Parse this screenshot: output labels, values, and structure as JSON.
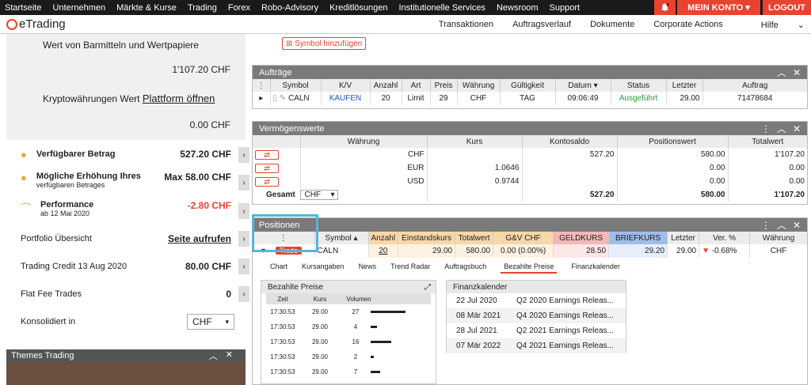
{
  "topnav": {
    "items": [
      "Startseite",
      "Unternehmen",
      "Märkte & Kurse",
      "Trading",
      "Forex",
      "Robo-Advisory",
      "Kreditlösungen",
      "Institutionelle Services",
      "Newsroom",
      "Support"
    ],
    "konto": "MEIN KONTO",
    "logout": "LOGOUT"
  },
  "subnav": {
    "logo": "eTrading",
    "links": [
      "Transaktionen",
      "Auftragsverlauf",
      "Dokumente",
      "Corporate Actions",
      "Hilfe"
    ]
  },
  "left": {
    "wert_label": "Wert von Barmitteln und Wertpapiere",
    "wert_value": "1'107.20 CHF",
    "krypto_label": "Kryptowährungen Wert",
    "krypto_link": "Plattform öffnen",
    "krypto_value": "0.00 CHF",
    "verf_label": "Verfügbarer Betrag",
    "verf_value": "527.20 CHF",
    "erh_label1": "Mögliche Erhöhung Ihres",
    "erh_label2": "verfügbaren Betrages",
    "erh_value": "Max 58.00 CHF",
    "perf_label": "Performance",
    "perf_date": "ab 12 Mai 2020",
    "perf_value": "-2.80 CHF",
    "portfolio_label": "Portfolio Übersicht",
    "portfolio_link": "Seite aufrufen",
    "credit_label": "Trading Credit 13 Aug 2020",
    "credit_value": "80.00 CHF",
    "flat_label": "Flat Fee Trades",
    "flat_value": "0",
    "kons_label": "Konsolidiert in",
    "kons_value": "CHF",
    "themes_title": "Themes Trading"
  },
  "symbol_add": "Symbol hinzufügen",
  "auftraege": {
    "title": "Aufträge",
    "headers": [
      "Symbol",
      "K/V",
      "Anzahl",
      "Art",
      "Preis",
      "Währung",
      "Gültigkeit",
      "Datum",
      "Status",
      "Letzter",
      "Auftrag"
    ],
    "row": {
      "symbol": "CALN",
      "kv": "KAUFEN",
      "anzahl": "20",
      "art": "Limit",
      "preis": "29",
      "waehrung": "CHF",
      "gueltigkeit": "TAG",
      "datum": "09:06:49",
      "status": "Ausgeführt",
      "letzter": "29.00",
      "auftrag": "71478684"
    }
  },
  "vermoegen": {
    "title": "Vermögenswerte",
    "headers": [
      "Währung",
      "Kurs",
      "Kontosaldo",
      "Positionswert",
      "Totalwert"
    ],
    "rows": [
      {
        "w": "CHF",
        "k": "",
        "s": "527.20",
        "p": "580.00",
        "t": "1'107.20"
      },
      {
        "w": "EUR",
        "k": "1.0646",
        "s": "",
        "p": "0.00",
        "t": "0.00"
      },
      {
        "w": "USD",
        "k": "0.9744",
        "s": "",
        "p": "0.00",
        "t": "0.00"
      }
    ],
    "gesamt_label": "Gesamt",
    "gesamt_cur": "CHF",
    "gesamt": {
      "s": "527.20",
      "p": "580.00",
      "t": "1'107.20"
    }
  },
  "positionen": {
    "title": "Positionen",
    "headers": [
      "Symbol",
      "Anzahl",
      "Einstandskurs",
      "Totalwert",
      "G&V CHF",
      "GELDKURS",
      "BRIEFKURS",
      "Letzter",
      "Ver. %",
      "Währung"
    ],
    "trade": "Trade",
    "row": {
      "symbol": "CALN",
      "anzahl": "20",
      "einstand": "29.00",
      "total": "580.00",
      "gv": "0.00 (0.00%)",
      "geld": "28.50",
      "brief": "29.20",
      "letzter": "29.00",
      "ver": "-0.68%",
      "waehrung": "CHF"
    },
    "tabs": [
      "Chart",
      "Kursangaben",
      "News",
      "Trend Radar",
      "Auftragsbuch",
      "Bezahlte Preise",
      "Finanzkalender"
    ]
  },
  "bezahlte": {
    "title": "Bezahlte Preise",
    "headers": [
      "Zeit",
      "Kurs",
      "Volumen"
    ],
    "rows": [
      {
        "z": "17:30:53",
        "k": "29.00",
        "v": "27"
      },
      {
        "z": "17:30:53",
        "k": "29.00",
        "v": "4"
      },
      {
        "z": "17:30:53",
        "k": "29.00",
        "v": "16"
      },
      {
        "z": "17:30:53",
        "k": "29.00",
        "v": "2"
      },
      {
        "z": "17:30:53",
        "k": "29.00",
        "v": "7"
      }
    ]
  },
  "finanz": {
    "title": "Finanzkalender",
    "rows": [
      {
        "d": "22 Jul 2020",
        "t": "Q2 2020 Earnings Releas..."
      },
      {
        "d": "08 Mär 2021",
        "t": "Q4 2020 Earnings Releas..."
      },
      {
        "d": "28 Jul 2021",
        "t": "Q2 2021 Earnings Releas..."
      },
      {
        "d": "07 Mär 2022",
        "t": "Q4 2021 Earnings Releas..."
      }
    ]
  },
  "colors": {
    "accent": "#e8432e",
    "buy": "#2255cc",
    "ok": "#2a9a3a",
    "geld": "#f4b8b8",
    "brief": "#9fbde8",
    "highlight": "#5cb3d6"
  }
}
